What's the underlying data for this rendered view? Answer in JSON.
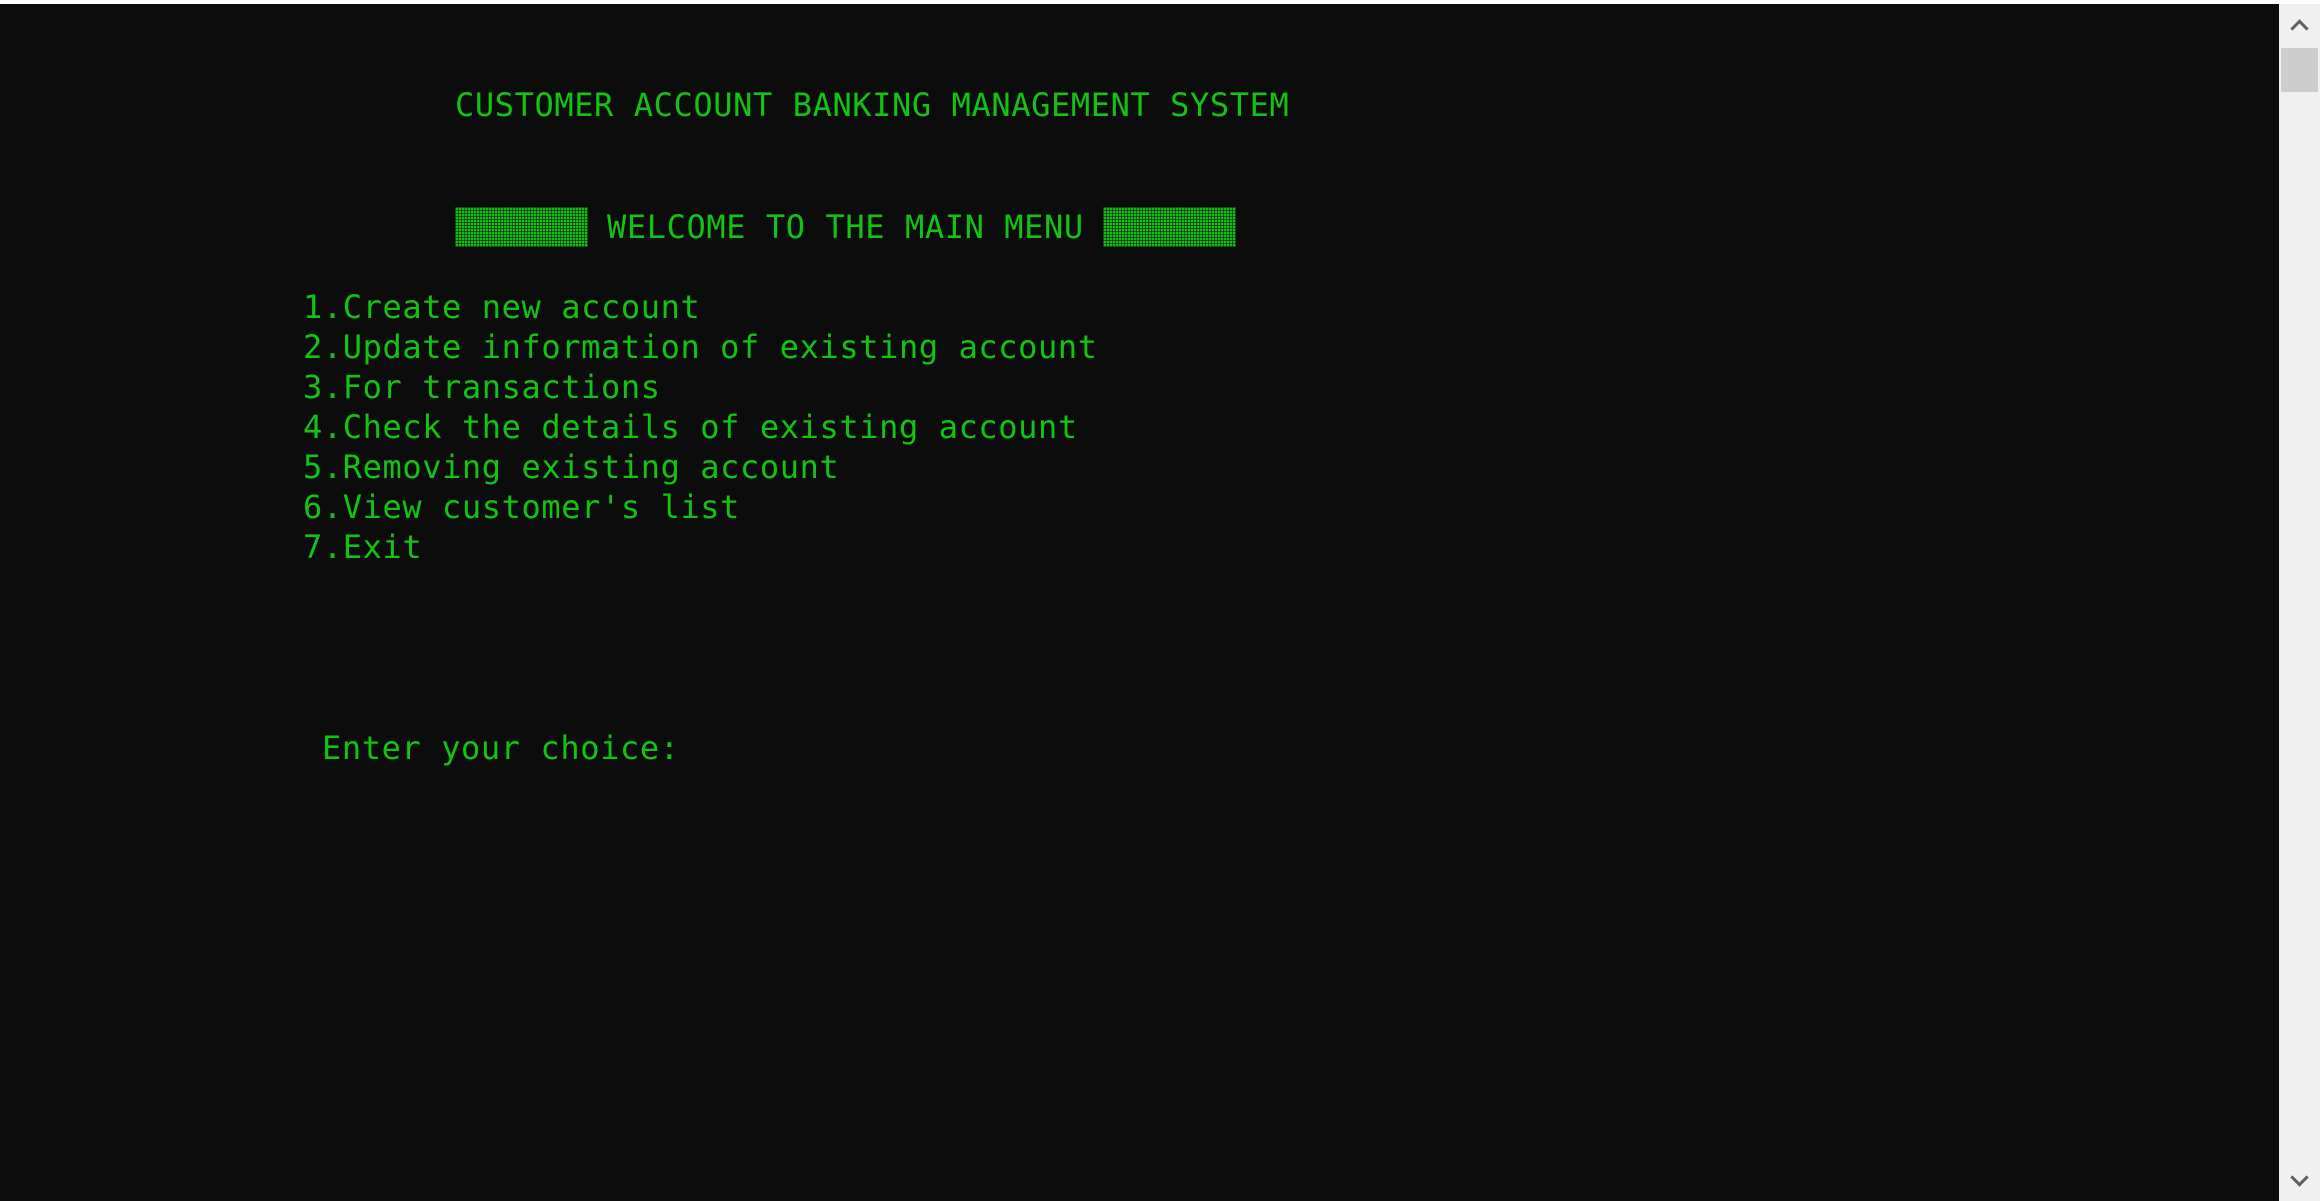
{
  "console": {
    "title": "CUSTOMER ACCOUNT BANKING MANAGEMENT SYSTEM",
    "banner": "WELCOME TO THE MAIN MENU",
    "menu_items": [
      {
        "label": "1.Create new account"
      },
      {
        "label": "2.Update information of existing account"
      },
      {
        "label": "3.For transactions"
      },
      {
        "label": "4.Check the details of existing account"
      },
      {
        "label": "5.Removing existing account"
      },
      {
        "label": "6.View customer's list"
      },
      {
        "label": "7.Exit"
      }
    ],
    "prompt": "Enter your choice:"
  },
  "colors": {
    "background": "#0c0c0c",
    "text": "#13c313",
    "scrollbar": "#f0f0f0"
  },
  "icons": {
    "banner_block": "shaded-block-glyph",
    "scroll_up": "chevron-up-icon",
    "scroll_down": "chevron-down-icon"
  }
}
